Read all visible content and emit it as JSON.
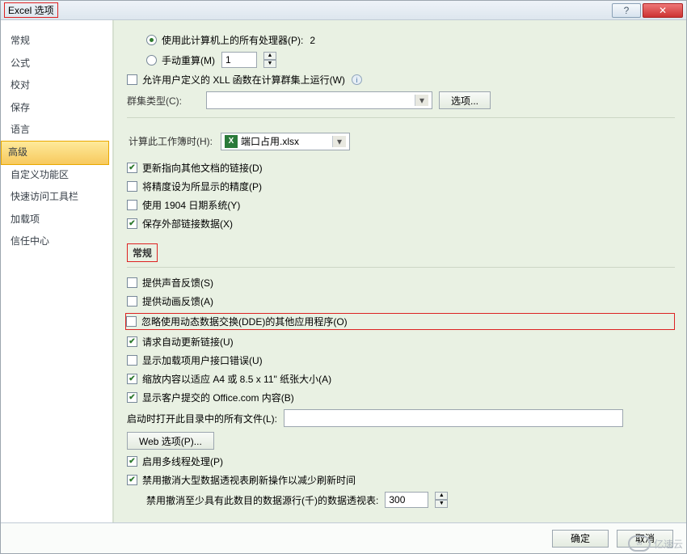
{
  "title": "Excel 选项",
  "sysbuttons": {
    "help": "?",
    "close": "✕"
  },
  "sidebar": {
    "items": [
      {
        "label": "常规"
      },
      {
        "label": "公式"
      },
      {
        "label": "校对"
      },
      {
        "label": "保存"
      },
      {
        "label": "语言"
      },
      {
        "label": "高级",
        "selected": true
      },
      {
        "label": "自定义功能区"
      },
      {
        "label": "快速访问工具栏"
      },
      {
        "label": "加载项"
      },
      {
        "label": "信任中心"
      }
    ]
  },
  "processors": {
    "use_all_label": "使用此计算机上的所有处理器(P):",
    "use_all_count": "2",
    "manual_label": "手动重算(M)",
    "manual_value": "1"
  },
  "xll": {
    "label": "允许用户定义的 XLL 函数在计算群集上运行(W)",
    "cluster_label": "群集类型(C):",
    "options_btn": "选项..."
  },
  "workbook_calc": {
    "header": "计算此工作簿时(H):",
    "selected": "端口占用.xlsx",
    "cb_update_links": "更新指向其他文档的链接(D)",
    "cb_precision": "将精度设为所显示的精度(P)",
    "cb_1904": "使用 1904 日期系统(Y)",
    "cb_save_ext_links": "保存外部链接数据(X)"
  },
  "general": {
    "header": "常规",
    "cb_sound": "提供声音反馈(S)",
    "cb_anim": "提供动画反馈(A)",
    "cb_dde": "忽略使用动态数据交换(DDE)的其他应用程序(O)",
    "cb_auto_update_links": "请求自动更新链接(U)",
    "cb_addin_errors": "显示加载项用户接口错误(U)",
    "cb_scale": "缩放内容以适应 A4 或 8.5 x 11\" 纸张大小(A)",
    "cb_office_com": "显示客户提交的 Office.com 内容(B)",
    "startup_label": "启动时打开此目录中的所有文件(L):",
    "web_options_btn": "Web 选项(P)...",
    "cb_multithread": "启用多线程处理(P)",
    "cb_pivot_undo": "禁用撤消大型数据透视表刷新操作以减少刷新时间",
    "pivot_rows_label": "禁用撤消至少具有此数目的数据源行(千)的数据透视表:",
    "pivot_rows_value": "300"
  },
  "buttons": {
    "ok": "确定",
    "cancel": "取消"
  },
  "watermark": "亿速云"
}
